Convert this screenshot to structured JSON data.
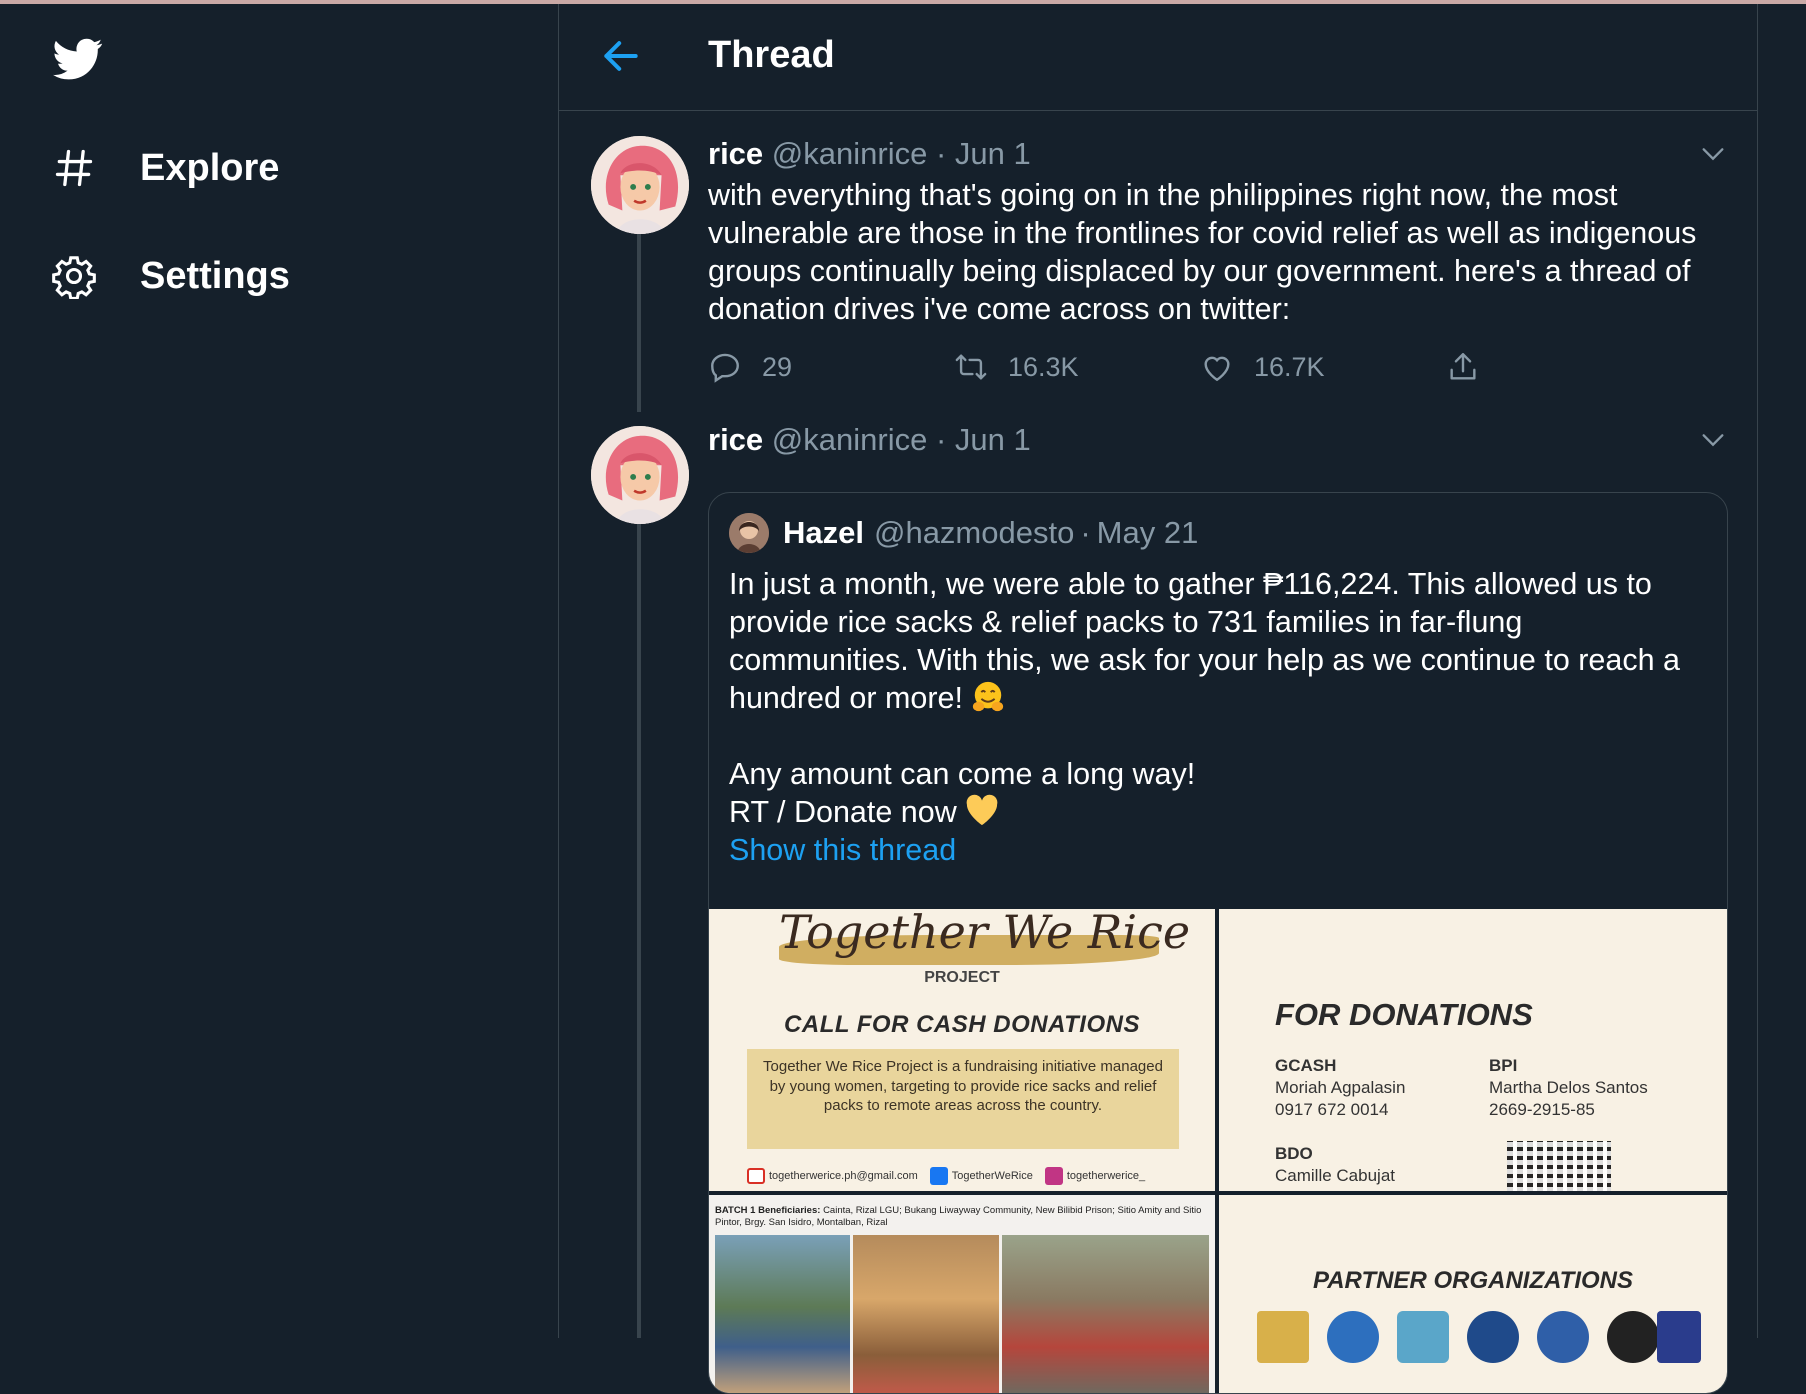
{
  "colors": {
    "background": "#15202b",
    "border": "#38444d",
    "text_primary": "#ffffff",
    "text_secondary": "#8899a6",
    "accent": "#1da1f2"
  },
  "sidebar": {
    "logo_icon": "twitter-bird-icon",
    "items": [
      {
        "label": "Explore",
        "icon": "hashtag-icon"
      },
      {
        "label": "Settings",
        "icon": "gear-icon"
      }
    ]
  },
  "header": {
    "back_icon": "arrow-left-icon",
    "title": "Thread"
  },
  "tweets": [
    {
      "name": "rice",
      "handle": "@kaninrice",
      "separator": "·",
      "date": "Jun 1",
      "text": "with everything that's going on in the philippines right now, the most vulnerable are those in the frontlines for covid relief as well as indigenous groups continually being displaced by our government. here's a thread of donation drives i've come across on twitter:",
      "replies": "29",
      "retweets": "16.3K",
      "likes": "16.7K"
    },
    {
      "name": "rice",
      "handle": "@kaninrice",
      "separator": "·",
      "date": "Jun 1",
      "quote": {
        "name": "Hazel",
        "handle": "@hazmodesto",
        "separator": "·",
        "date": "May 21",
        "paragraph1": "In just a month, we were able to gather ₱116,224. This allowed us to provide rice sacks & relief packs to 731 families in far-flung communities. With this, we ask for your help as we continue to reach a hundred or more!",
        "line2": "Any amount can come a long way!",
        "line3": "RT / Donate now",
        "show_thread": "Show this thread",
        "media": {
          "tile1": {
            "script_title": "Together We Rice",
            "subtitle": "PROJECT",
            "heading": "CALL FOR CASH DONATIONS",
            "description": "Together We Rice Project is a fundraising initiative managed by young women, targeting to provide rice sacks and relief packs to remote areas across the country.",
            "email": "togetherwerice.ph@gmail.com",
            "facebook": "TogetherWeRice",
            "instagram": "togetherwerice_"
          },
          "tile2": {
            "heading": "FOR DONATIONS",
            "gcash_label": "GCASH",
            "gcash_name": "Moriah Agpalasin",
            "gcash_number": "0917 672 0014",
            "bpi_label": "BPI",
            "bpi_name": "Martha Delos Santos",
            "bpi_number": "2669-2915-85",
            "bdo_label": "BDO",
            "bdo_name": "Camille Cabujat"
          },
          "tile3": {
            "batch_label": "BATCH 1 Beneficiaries:",
            "batch_text": "Cainta, Rizal LGU; Bukang Liwayway Community, New Bilibid Prison; Sitio Amity and Sitio Pintor, Brgy. San Isidro, Montalban, Rizal"
          },
          "tile4": {
            "heading": "PARTNER ORGANIZATIONS"
          }
        }
      }
    }
  ]
}
